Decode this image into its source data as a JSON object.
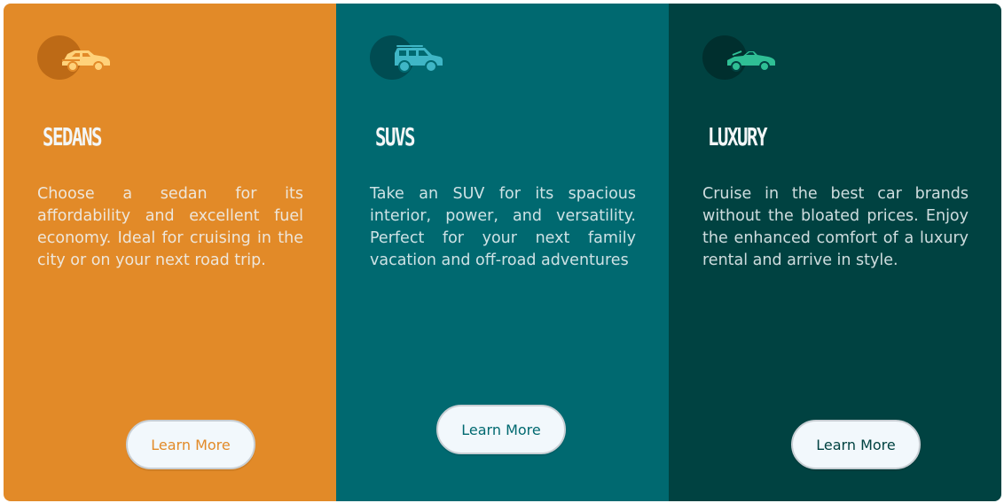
{
  "cards": [
    {
      "title": "SEDANS",
      "description": "Choose a sedan for its affordability and excellent fuel economy. Ideal for cruising in the city or on your next road trip.",
      "button_label": "Learn More",
      "icon": "sedan-car-icon",
      "color": "#e28a28",
      "icon_color": "#ffd27a"
    },
    {
      "title": "SUVS",
      "description": "Take an SUV for its spacious interior, power, and versatility. Perfect for your next family vacation and off-road adventures",
      "button_label": "Learn More",
      "icon": "suv-car-icon",
      "color": "#006970",
      "icon_color": "#3fb6c6"
    },
    {
      "title": "LUXURY",
      "description": "Cruise in the best car brands without the bloated prices. Enjoy the enhanced comfort of a luxury rental and arrive in style.",
      "button_label": "Learn More",
      "icon": "luxury-car-icon",
      "color": "#004241",
      "icon_color": "#2fbf95"
    }
  ]
}
